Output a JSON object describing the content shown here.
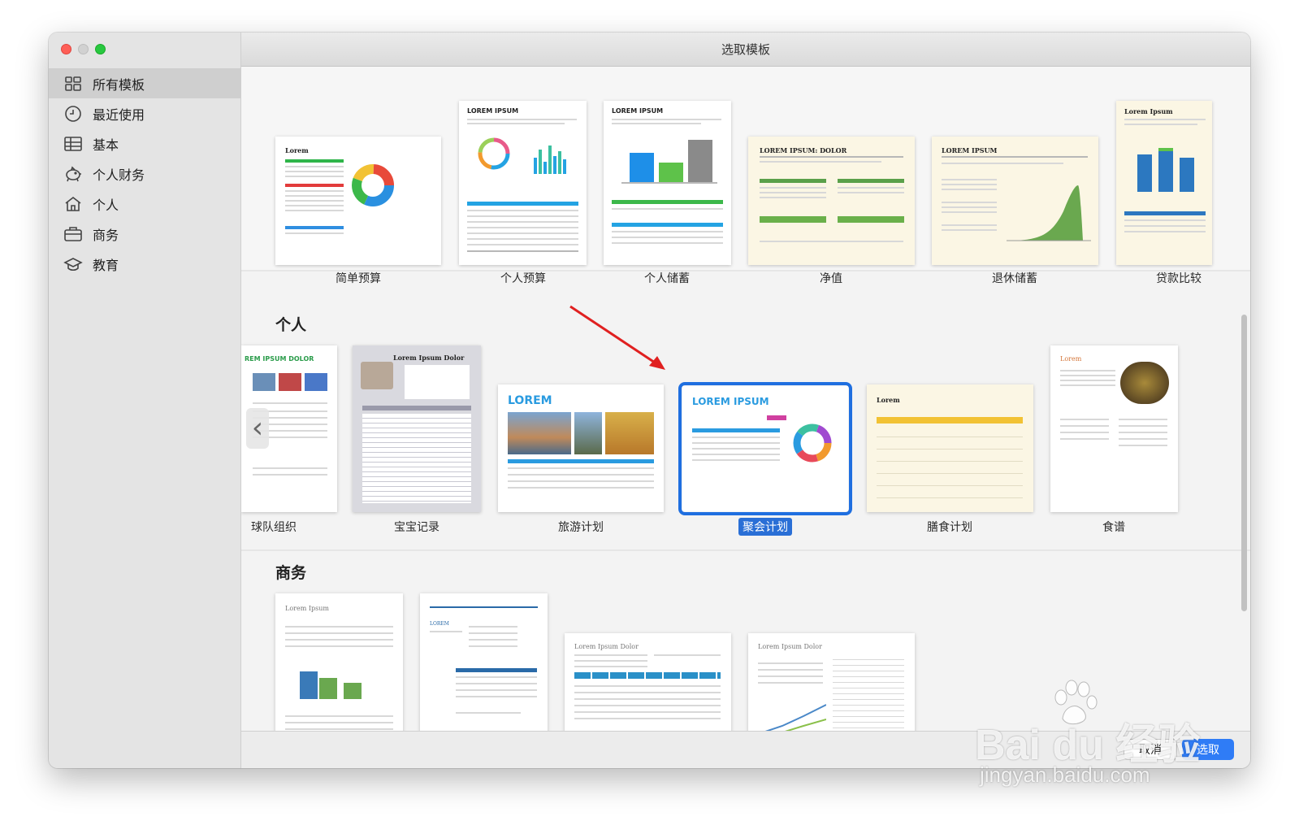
{
  "window": {
    "title": "选取模板"
  },
  "sidebar": {
    "items": [
      {
        "label": "所有模板",
        "icon": "grid-icon"
      },
      {
        "label": "最近使用",
        "icon": "clock-icon"
      },
      {
        "label": "基本",
        "icon": "table-icon"
      },
      {
        "label": "个人财务",
        "icon": "piggy-bank-icon"
      },
      {
        "label": "个人",
        "icon": "house-icon"
      },
      {
        "label": "商务",
        "icon": "briefcase-icon"
      },
      {
        "label": "教育",
        "icon": "graduation-cap-icon"
      }
    ],
    "selected_index": 0
  },
  "sections": {
    "finance_row": {
      "templates": [
        "简单预算",
        "个人预算",
        "个人储蓄",
        "净值",
        "退休储蓄",
        "贷款比较"
      ],
      "thumb_texts": [
        "Lorem",
        "LOREM IPSUM",
        "LOREM IPSUM",
        "LOREM IPSUM: DOLOR",
        "LOREM IPSUM",
        "Lorem Ipsum"
      ]
    },
    "personal": {
      "title": "个人",
      "templates": [
        "球队组织",
        "宝宝记录",
        "旅游计划",
        "聚会计划",
        "膳食计划",
        "食谱"
      ],
      "thumb_texts": [
        "REM IPSUM DOLOR",
        "Lorem Ipsum Dolor",
        "LOREM",
        "LOREM IPSUM",
        "Lorem",
        "Lorem"
      ],
      "selected": "聚会计划"
    },
    "business": {
      "title": "商务",
      "thumb_texts": [
        "Lorem Ipsum",
        "LOREM",
        "Lorem Ipsum Dolor",
        "Lorem Ipsum Dolor"
      ]
    }
  },
  "buttons": {
    "cancel": "取消",
    "choose": "选取"
  },
  "watermark": {
    "logo": "Bai du 经验",
    "url": "jingyan.baidu.com"
  },
  "colors": {
    "accent": "#1f6fe0",
    "annotation_arrow": "#e02020"
  }
}
